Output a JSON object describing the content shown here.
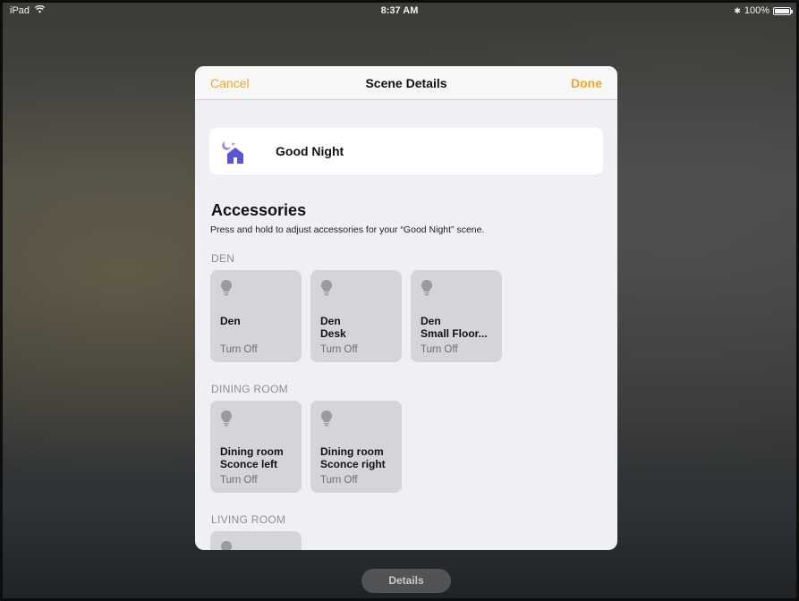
{
  "status_bar": {
    "device": "iPad",
    "time": "8:37 AM",
    "bluetooth_glyph": "✱",
    "battery": "100%",
    "wifi_icon": "wifi-icon"
  },
  "sheet": {
    "cancel_label": "Cancel",
    "title": "Scene Details",
    "done_label": "Done",
    "accent_color": "#f5a623"
  },
  "scene": {
    "name": "Good Night",
    "icon": "good-night-scene-icon"
  },
  "accessories": {
    "title": "Accessories",
    "subtitle": "Press and hold to adjust accessories for your “Good Night” scene.",
    "rooms": [
      {
        "label": "DEN",
        "tiles": [
          {
            "line1": "Den",
            "line2": "",
            "state": "Turn Off"
          },
          {
            "line1": "Den",
            "line2": "Desk",
            "state": "Turn Off"
          },
          {
            "line1": "Den",
            "line2": "Small Floor...",
            "state": "Turn Off"
          }
        ]
      },
      {
        "label": "DINING ROOM",
        "tiles": [
          {
            "line1": "Dining room",
            "line2": "Sconce left",
            "state": "Turn Off"
          },
          {
            "line1": "Dining room",
            "line2": "Sconce right",
            "state": "Turn Off"
          }
        ]
      },
      {
        "label": "LIVING ROOM",
        "tiles": []
      }
    ]
  },
  "bottom": {
    "details_label": "Details"
  }
}
